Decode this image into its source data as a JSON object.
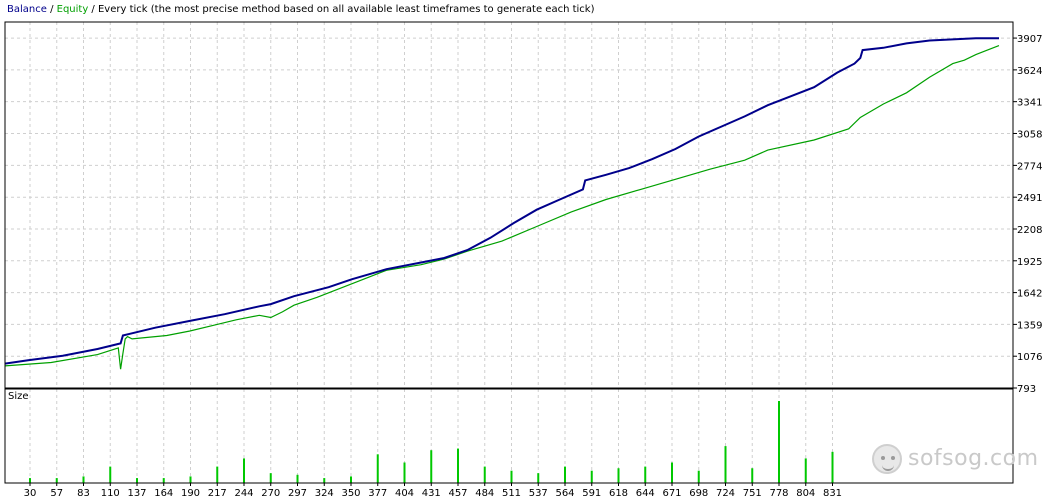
{
  "legend": {
    "balance": "Balance",
    "sep1": " / ",
    "equity": "Equity",
    "sep2": " / ",
    "method": "Every tick (the most precise method based on all available least timeframes to generate each tick)"
  },
  "colors": {
    "balance": "#00008b",
    "equity": "#00a000",
    "volume": "#00c800",
    "grid": "#cfcfcf",
    "frame": "#000000"
  },
  "watermark": {
    "text": "sofsog.com",
    "icon": "face-icon"
  },
  "chart_data": [
    {
      "type": "line",
      "title": "",
      "ylim": [
        793,
        4050
      ],
      "y_ticks": [
        793,
        1076,
        1359,
        1642,
        1925,
        2208,
        2491,
        2774,
        3058,
        3341,
        3624,
        3907
      ],
      "xlim": [
        0,
        860
      ],
      "grid": true,
      "series": [
        {
          "name": "Balance",
          "x": [
            0,
            20,
            50,
            80,
            100,
            102,
            130,
            160,
            190,
            220,
            230,
            250,
            280,
            300,
            330,
            360,
            380,
            400,
            420,
            440,
            460,
            480,
            500,
            502,
            520,
            540,
            560,
            580,
            600,
            620,
            640,
            660,
            680,
            700,
            720,
            735,
            740,
            742,
            760,
            780,
            800,
            820,
            840,
            850,
            860
          ],
          "y": [
            1010,
            1040,
            1080,
            1140,
            1190,
            1260,
            1330,
            1390,
            1450,
            1520,
            1540,
            1610,
            1690,
            1760,
            1850,
            1910,
            1950,
            2020,
            2130,
            2260,
            2380,
            2470,
            2560,
            2640,
            2690,
            2750,
            2830,
            2920,
            3030,
            3120,
            3210,
            3310,
            3390,
            3470,
            3600,
            3680,
            3730,
            3800,
            3820,
            3860,
            3885,
            3895,
            3905,
            3905,
            3905
          ]
        },
        {
          "name": "Equity",
          "x": [
            0,
            40,
            80,
            98,
            100,
            102,
            104,
            106,
            110,
            140,
            160,
            180,
            200,
            220,
            230,
            240,
            250,
            270,
            290,
            310,
            330,
            360,
            380,
            400,
            430,
            460,
            490,
            520,
            550,
            580,
            610,
            640,
            660,
            700,
            730,
            740,
            760,
            780,
            800,
            820,
            830,
            840,
            850,
            860
          ],
          "y": [
            990,
            1020,
            1090,
            1150,
            960,
            1100,
            1230,
            1250,
            1230,
            1260,
            1300,
            1350,
            1400,
            1440,
            1420,
            1470,
            1530,
            1600,
            1680,
            1760,
            1840,
            1890,
            1940,
            2010,
            2100,
            2230,
            2360,
            2470,
            2560,
            2650,
            2740,
            2820,
            2910,
            3000,
            3100,
            3200,
            3320,
            3420,
            3560,
            3680,
            3710,
            3760,
            3800,
            3840
          ]
        }
      ]
    },
    {
      "type": "bar",
      "title": "Size",
      "categories": [
        "30",
        "57",
        "83",
        "110",
        "137",
        "164",
        "190",
        "217",
        "244",
        "270",
        "297",
        "324",
        "350",
        "377",
        "404",
        "431",
        "457",
        "484",
        "511",
        "537",
        "564",
        "591",
        "618",
        "644",
        "671",
        "698",
        "724",
        "751",
        "778",
        "804",
        "831"
      ],
      "values": [
        0.06,
        0.06,
        0.08,
        0.2,
        0.06,
        0.06,
        0.08,
        0.2,
        0.3,
        0.12,
        0.1,
        0.06,
        0.08,
        0.35,
        0.25,
        0.4,
        0.42,
        0.2,
        0.15,
        0.12,
        0.2,
        0.15,
        0.18,
        0.2,
        0.25,
        0.15,
        0.45,
        0.18,
        1.0,
        0.3,
        0.38
      ]
    }
  ]
}
